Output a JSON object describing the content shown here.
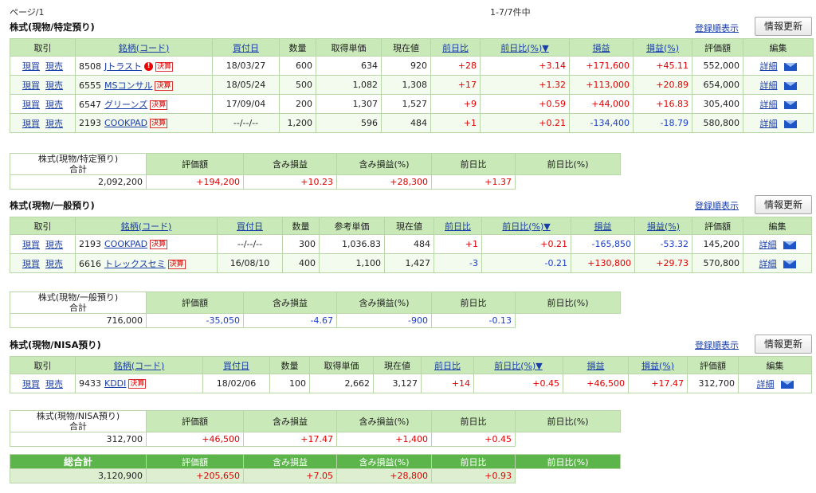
{
  "top": {
    "page_label": "ページ/1",
    "count_label": "1-7/7件中"
  },
  "common": {
    "register_order": "登録順表示",
    "update": "情報更新",
    "detail": "詳細",
    "buy": "現買",
    "sell": "現売",
    "kessan": "決算",
    "alert": "!"
  },
  "headers_a": [
    "取引",
    "銘柄(コード)",
    "買付日",
    "数量",
    "取得単価",
    "現在値",
    "前日比",
    "前日比(%)▼",
    "損益",
    "損益(%)",
    "評価額",
    "編集"
  ],
  "headers_b": [
    "取引",
    "銘柄(コード)",
    "買付日",
    "数量",
    "参考単価",
    "現在値",
    "前日比",
    "前日比(%)▼",
    "損益",
    "損益(%)",
    "評価額",
    "編集"
  ],
  "sum_headers": [
    "評価額",
    "含み損益",
    "含み損益(%)",
    "前日比",
    "前日比(%)"
  ],
  "sections": [
    {
      "title": "株式(現物/特定預り)",
      "rows": [
        {
          "code": "8508",
          "name": "Jトラスト",
          "alert": true,
          "date": "18/03/27",
          "qty": "600",
          "unit": "634",
          "price": "920",
          "chg": "+28",
          "chg_pct": "+3.14",
          "pl": "+171,600",
          "pl_pct": "+45.11",
          "value": "552,000"
        },
        {
          "code": "6555",
          "name": "MSコンサル",
          "alert": false,
          "date": "18/05/24",
          "qty": "500",
          "unit": "1,082",
          "price": "1,308",
          "chg": "+17",
          "chg_pct": "+1.32",
          "pl": "+113,000",
          "pl_pct": "+20.89",
          "value": "654,000"
        },
        {
          "code": "6547",
          "name": "グリーンズ",
          "alert": false,
          "date": "17/09/04",
          "qty": "200",
          "unit": "1,307",
          "price": "1,527",
          "chg": "+9",
          "chg_pct": "+0.59",
          "pl": "+44,000",
          "pl_pct": "+16.83",
          "value": "305,400"
        },
        {
          "code": "2193",
          "name": "COOKPAD",
          "alert": false,
          "date": "--/--/--",
          "qty": "1,200",
          "unit": "596",
          "price": "484",
          "chg": "+1",
          "chg_pct": "+0.21",
          "pl": "-134,400",
          "pl_pct": "-18.79",
          "value": "580,800"
        }
      ],
      "summary": {
        "label1": "株式(現物/特定預り)",
        "label2": "合計",
        "value": "2,092,200",
        "pl": "+194,200",
        "pl_pct": "+10.23",
        "chg": "+28,300",
        "chg_pct": "+1.37"
      }
    },
    {
      "title": "株式(現物/一般預り)",
      "rows": [
        {
          "code": "2193",
          "name": "COOKPAD",
          "alert": false,
          "date": "--/--/--",
          "qty": "300",
          "unit": "1,036.83",
          "price": "484",
          "chg": "+1",
          "chg_pct": "+0.21",
          "pl": "-165,850",
          "pl_pct": "-53.32",
          "value": "145,200"
        },
        {
          "code": "6616",
          "name": "トレックスセミ",
          "alert": false,
          "date": "16/08/10",
          "qty": "400",
          "unit": "1,100",
          "price": "1,427",
          "chg": "-3",
          "chg_pct": "-0.21",
          "pl": "+130,800",
          "pl_pct": "+29.73",
          "value": "570,800"
        }
      ],
      "summary": {
        "label1": "株式(現物/一般預り)",
        "label2": "合計",
        "value": "716,000",
        "pl": "-35,050",
        "pl_pct": "-4.67",
        "chg": "-900",
        "chg_pct": "-0.13"
      }
    },
    {
      "title": "株式(現物/NISA預り)",
      "rows": [
        {
          "code": "9433",
          "name": "KDDI",
          "alert": false,
          "date": "18/02/06",
          "qty": "100",
          "unit": "2,662",
          "price": "3,127",
          "chg": "+14",
          "chg_pct": "+0.45",
          "pl": "+46,500",
          "pl_pct": "+17.47",
          "value": "312,700"
        }
      ],
      "summary": {
        "label1": "株式(現物/NISA預り)",
        "label2": "合計",
        "value": "312,700",
        "pl": "+46,500",
        "pl_pct": "+17.47",
        "chg": "+1,400",
        "chg_pct": "+0.45"
      }
    }
  ],
  "grand": {
    "label": "総合計",
    "value": "3,120,900",
    "pl": "+205,650",
    "pl_pct": "+7.05",
    "chg": "+28,800",
    "chg_pct": "+0.93"
  },
  "colors": {
    "header_green": "#c9e9b8",
    "grand_green": "#5bb54a",
    "positive": "#e00000",
    "negative": "#1a3ec8",
    "link": "#1a3ea8"
  }
}
